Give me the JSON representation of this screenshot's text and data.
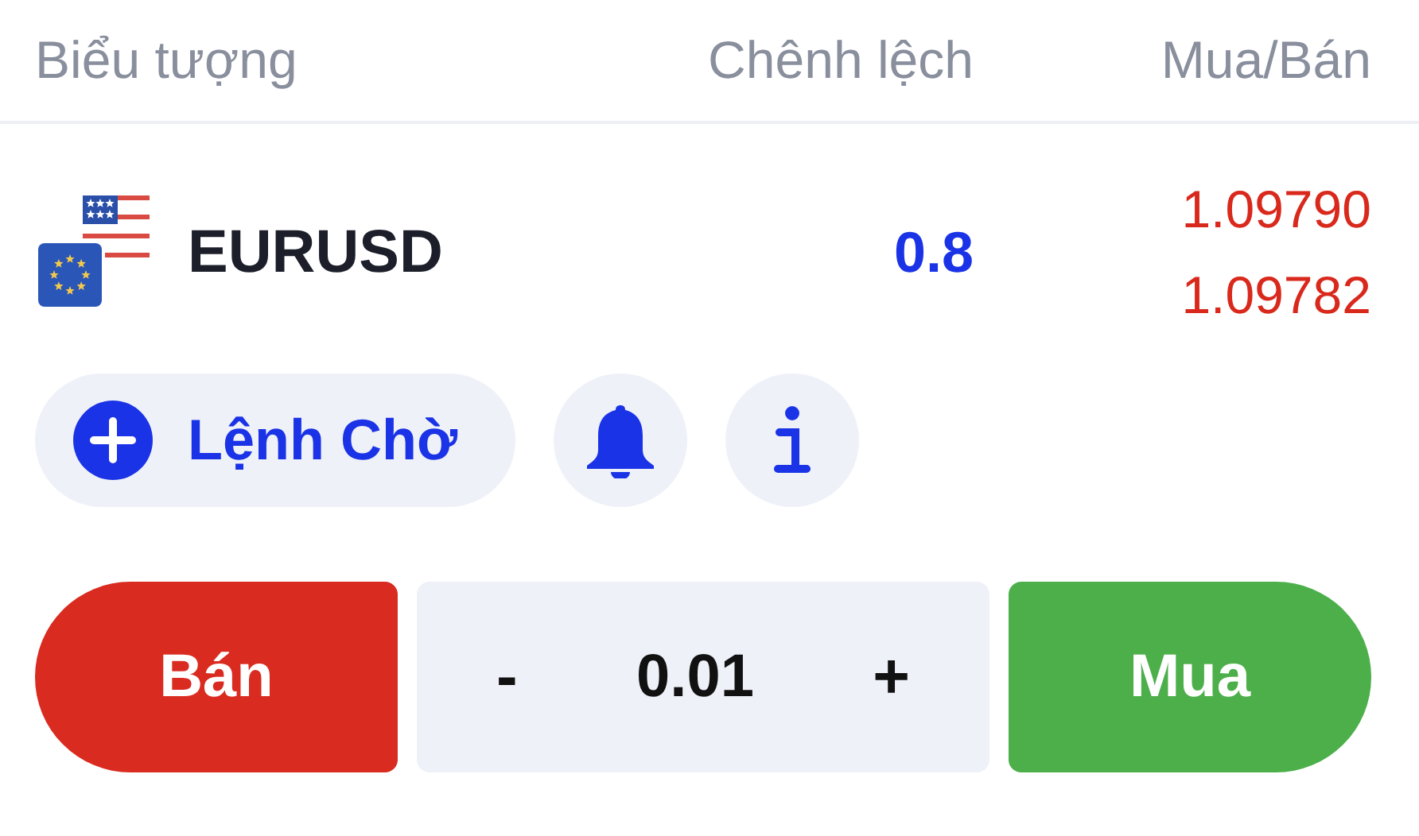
{
  "header": {
    "columns": [
      "Biểu tượng",
      "Chênh lệch",
      "Mua/Bán"
    ]
  },
  "instrument": {
    "symbol": "EURUSD",
    "spread": "0.8",
    "prices": [
      "1.09790",
      "1.09782"
    ]
  },
  "actions": {
    "pending_order": "Lệnh Chờ"
  },
  "trade": {
    "sell": "Bán",
    "minus": "-",
    "volume": "0.01",
    "plus": "+",
    "buy": "Mua"
  }
}
